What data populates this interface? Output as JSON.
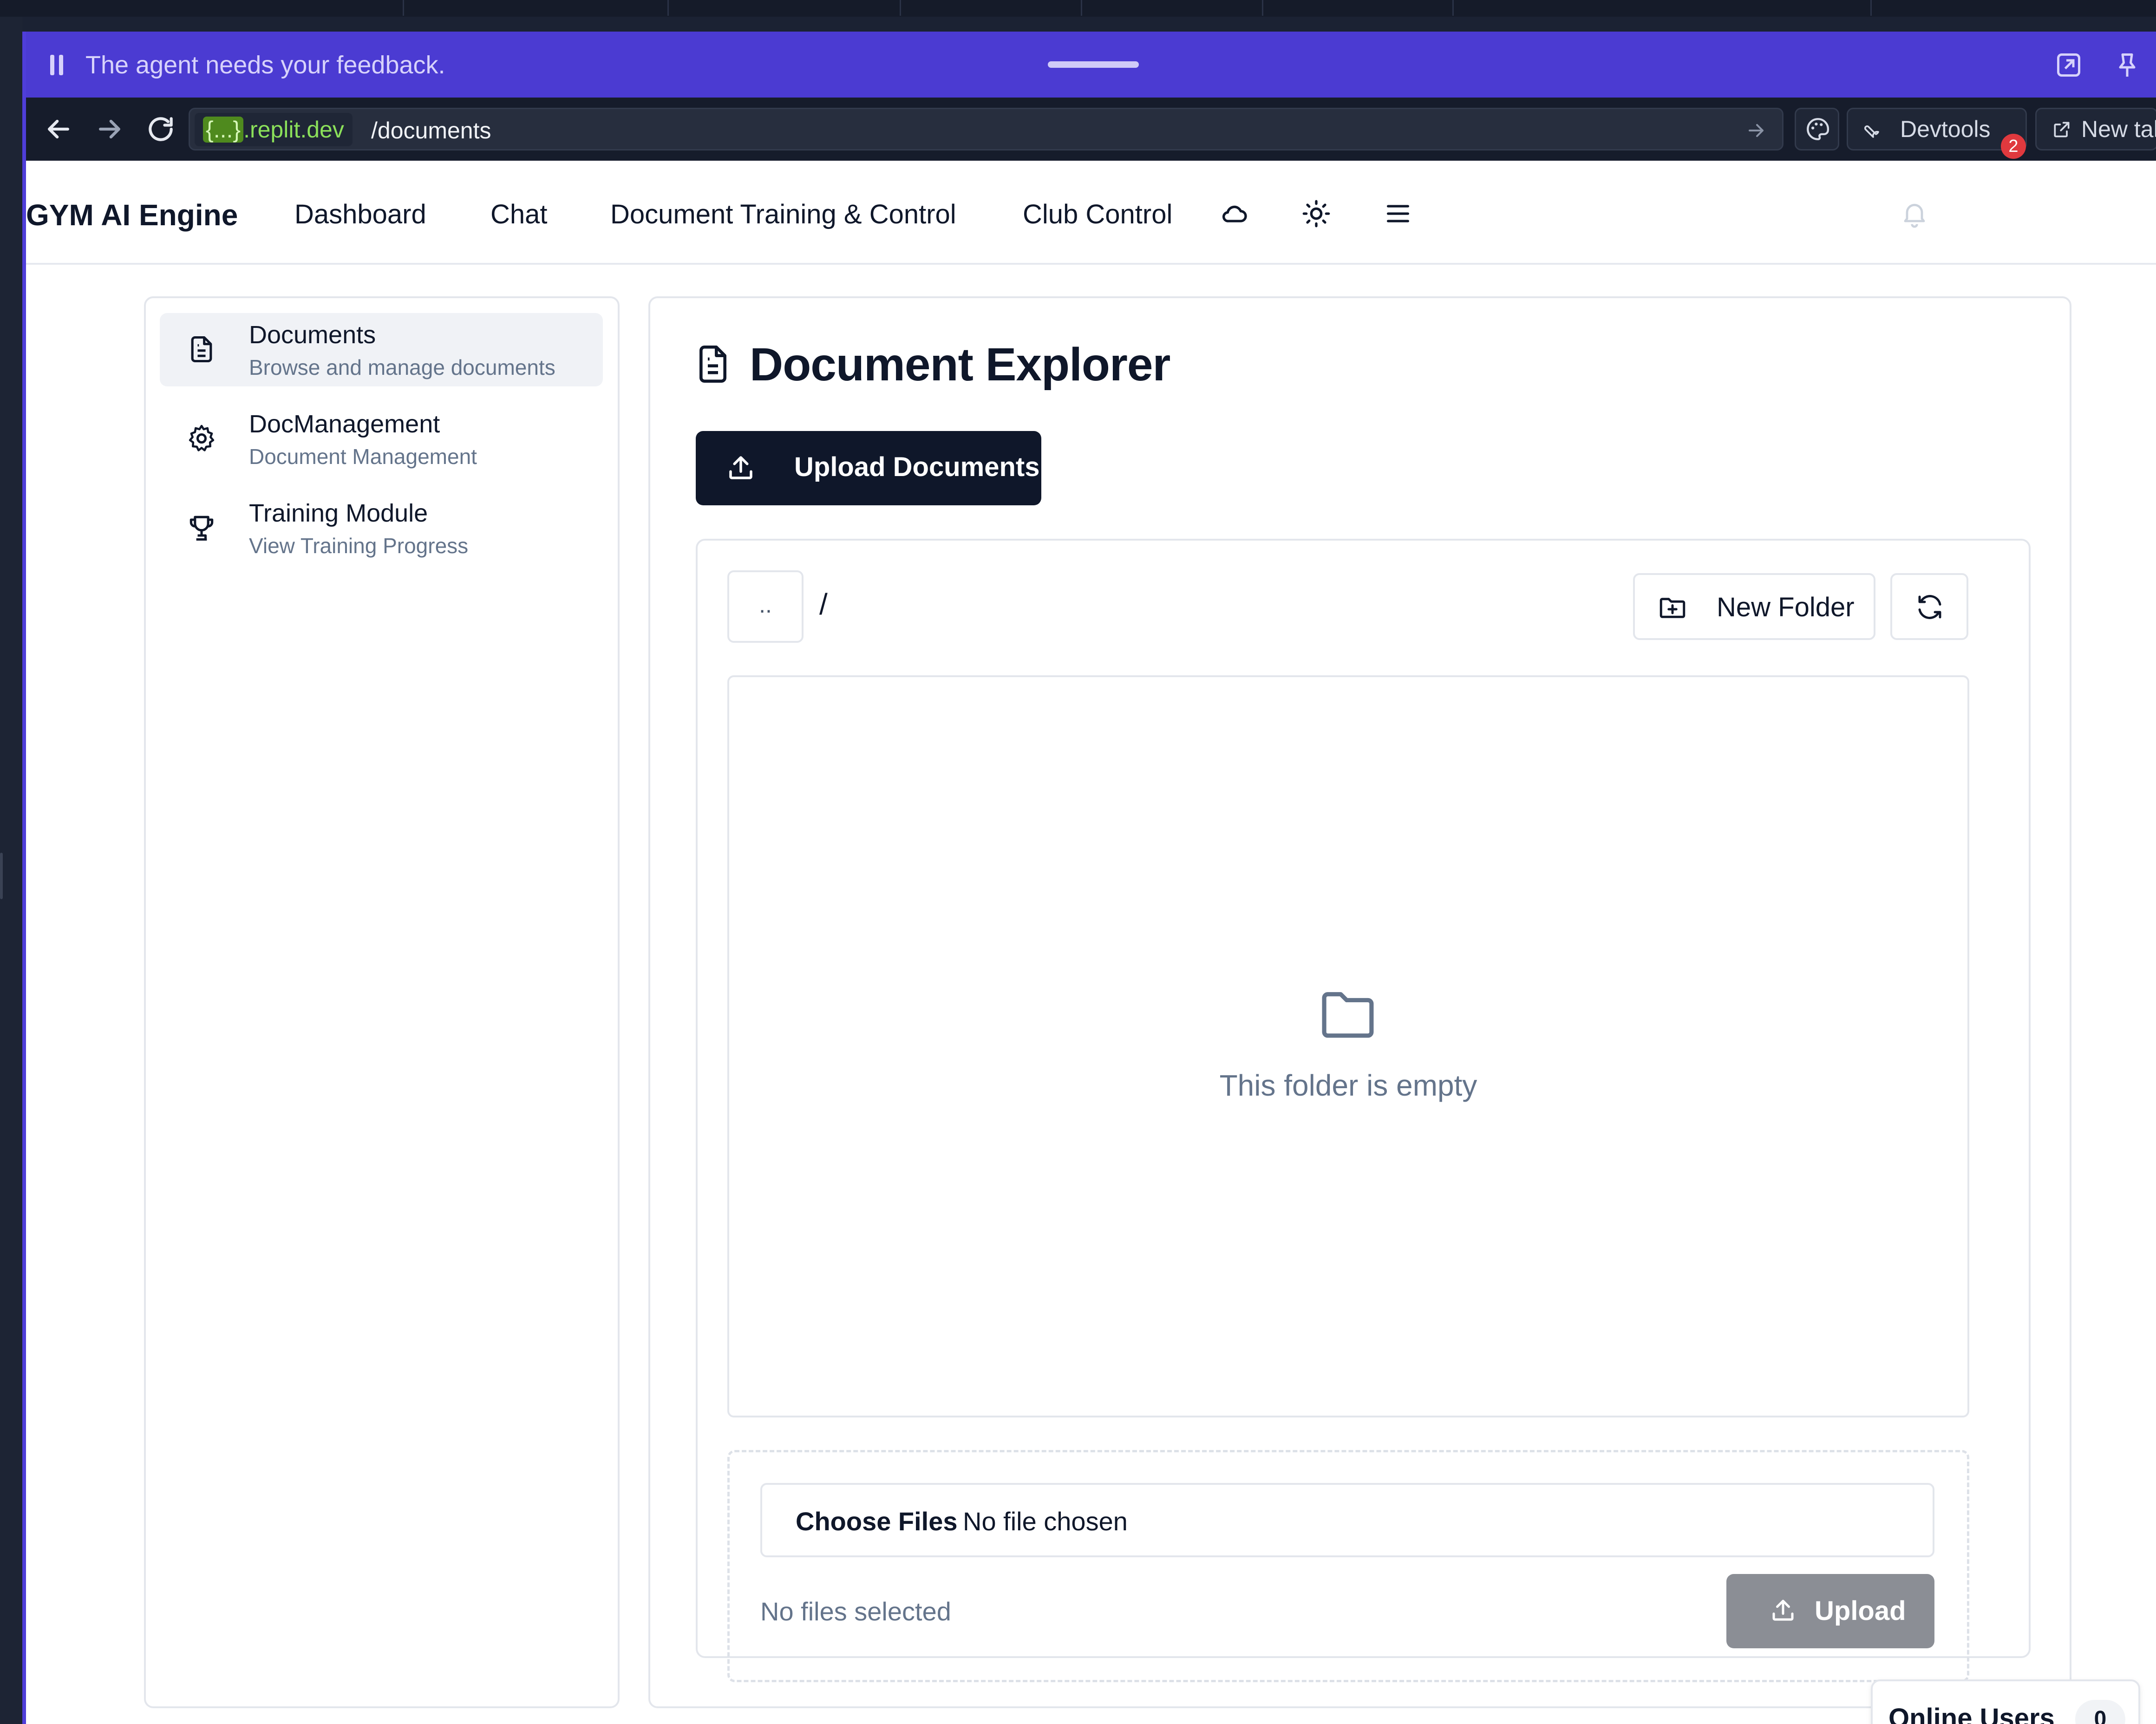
{
  "agent_bar": {
    "message": "The agent needs your feedback."
  },
  "browser": {
    "url_host_prefix": "{...}",
    "url_host_suffix": ".replit.dev",
    "url_path": "/documents",
    "devtools_label": "Devtools",
    "devtools_badge": "2",
    "new_tab_label": "New tab"
  },
  "app_nav": {
    "brand": "GYM AI Engine",
    "links": [
      "Dashboard",
      "Chat",
      "Document Training & Control",
      "Club Control"
    ]
  },
  "sidebar": {
    "items": [
      {
        "title": "Documents",
        "subtitle": "Browse and manage documents",
        "icon": "file-text-icon",
        "active": true
      },
      {
        "title": "DocManagement",
        "subtitle": "Document Management",
        "icon": "gear-icon",
        "active": false
      },
      {
        "title": "Training Module",
        "subtitle": "View Training Progress",
        "icon": "trophy-icon",
        "active": false
      }
    ]
  },
  "main": {
    "title": "Document Explorer",
    "upload_documents_label": "Upload Documents",
    "parent_dir_label": "..",
    "breadcrumb": "/",
    "new_folder_label": "New Folder",
    "empty_text": "This folder is empty",
    "choose_files_label": "Choose Files",
    "no_file_chosen": "No file chosen",
    "no_files_selected": "No files selected",
    "upload_label": "Upload"
  },
  "online_users": {
    "label": "Online Users",
    "count": "0"
  },
  "colors": {
    "agent_bar": "#4b3bd2",
    "primary_button": "#0f172a",
    "disabled_button": "#8b8e95",
    "url_host": "#8be05a"
  }
}
